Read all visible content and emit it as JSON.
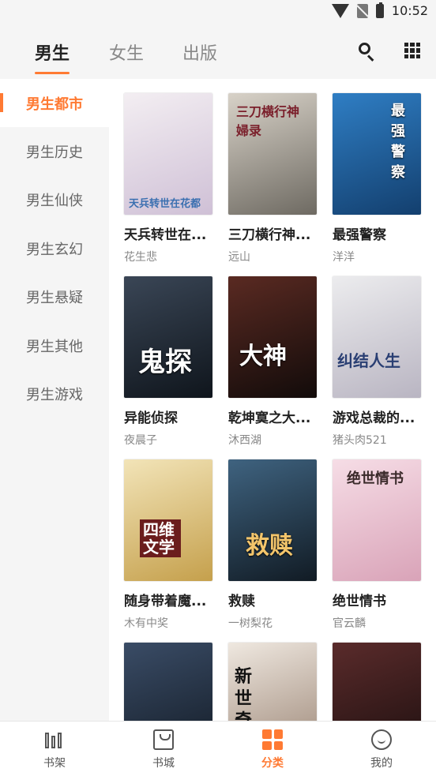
{
  "status": {
    "time": "10:52"
  },
  "tabs": [
    {
      "label": "男生",
      "active": true
    },
    {
      "label": "女生",
      "active": false
    },
    {
      "label": "出版",
      "active": false
    }
  ],
  "sidebar": {
    "items": [
      {
        "label": "男生都市",
        "active": true
      },
      {
        "label": "男生历史"
      },
      {
        "label": "男生仙侠"
      },
      {
        "label": "男生玄幻"
      },
      {
        "label": "男生悬疑"
      },
      {
        "label": "男生其他"
      },
      {
        "label": "男生游戏"
      }
    ]
  },
  "books": [
    {
      "title": "天兵转世在...",
      "author": "花生悲",
      "cover_text": "天兵转世在花都",
      "cover_colors": [
        "#f3eef2",
        "#cfc0d6"
      ]
    },
    {
      "title": "三刀横行神...",
      "author": "远山",
      "cover_text": "三刀横行神婦录",
      "cover_colors": [
        "#d8d2c8",
        "#6e6a62"
      ]
    },
    {
      "title": "最强警察",
      "author": "洋洋",
      "cover_text": "最强警察",
      "cover_colors": [
        "#2f7ec4",
        "#133f6e"
      ]
    },
    {
      "title": "异能侦探",
      "author": "夜晨子",
      "cover_text": "鬼探",
      "cover_colors": [
        "#3a4656",
        "#0f151c"
      ]
    },
    {
      "title": "乾坤寞之大...",
      "author": "沐西湖",
      "cover_text": "大神",
      "cover_colors": [
        "#5a2a22",
        "#120b0a"
      ]
    },
    {
      "title": "游戏总裁的...",
      "author": "猪头肉521",
      "cover_text": "纠结人生",
      "cover_colors": [
        "#ececee",
        "#b9b5c2"
      ]
    },
    {
      "title": "随身带着魔...",
      "author": "木有中奖",
      "cover_text": "四维文学",
      "cover_colors": [
        "#f2e4b8",
        "#c5a04c"
      ]
    },
    {
      "title": "救赎",
      "author": "一树梨花",
      "cover_text": "救赎",
      "cover_colors": [
        "#3f6380",
        "#111b24"
      ]
    },
    {
      "title": "绝世情书",
      "author": "官云麟",
      "cover_text": "绝世情书",
      "cover_colors": [
        "#f6dde6",
        "#d9a3b8"
      ]
    },
    {
      "title": "",
      "author": "",
      "cover_text": "",
      "cover_colors": [
        "#3a4c66",
        "#121a24"
      ]
    },
    {
      "title": "",
      "author": "",
      "cover_text": "新世奇",
      "cover_colors": [
        "#efe8e0",
        "#9a8474"
      ]
    },
    {
      "title": "",
      "author": "",
      "cover_text": "",
      "cover_colors": [
        "#5a2b2b",
        "#1b0e0e"
      ]
    }
  ],
  "bottom_nav": [
    {
      "label": "书架",
      "icon": "shelf-icon",
      "active": false
    },
    {
      "label": "书城",
      "icon": "store-icon",
      "active": false
    },
    {
      "label": "分类",
      "icon": "category-icon",
      "active": true
    },
    {
      "label": "我的",
      "icon": "profile-icon",
      "active": false
    }
  ],
  "accent_color": "#ff7a33"
}
